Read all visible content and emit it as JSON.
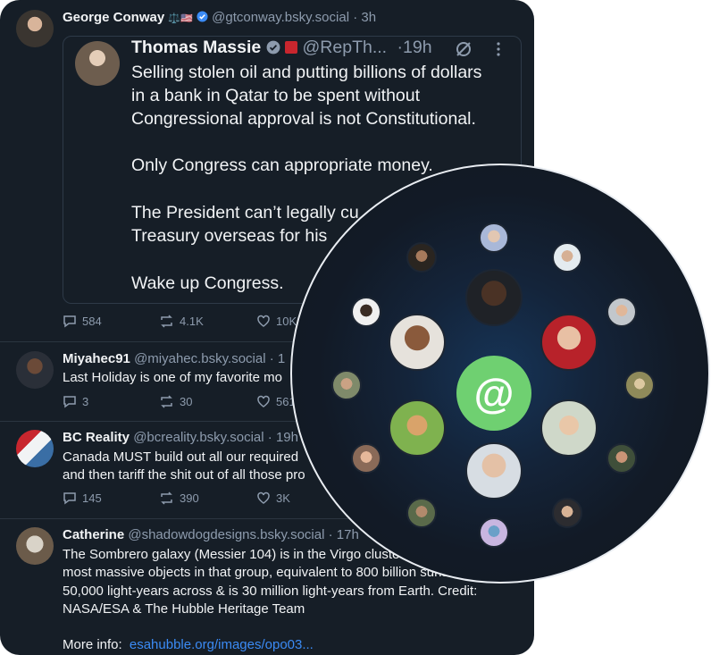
{
  "posts": [
    {
      "author": "George Conway",
      "badges": "⚖️🇺🇸",
      "handle": "@gtconway.bsky.social",
      "time": "3h",
      "quote": {
        "author": "Thomas Massie",
        "handle": "@RepTh...",
        "time": "19h",
        "lines": [
          "Selling stolen oil and putting billions of dollars",
          "in a bank in Qatar to be spent without",
          "Congressional approval is not Constitutional.",
          "",
          "Only Congress can appropriate money.",
          "",
          "The President can’t legally cu",
          "Treasury overseas for his",
          "",
          "Wake up Congress."
        ]
      },
      "replies": "584",
      "reposts": "4.1K",
      "likes": "10K"
    },
    {
      "author": "Miyahec91",
      "handle": "@miyahec.bsky.social",
      "time": "1",
      "lines": [
        "Last Holiday is one of my favorite mo"
      ],
      "replies": "3",
      "reposts": "30",
      "likes": "561"
    },
    {
      "author": "BC Reality",
      "handle": "@bcreality.bsky.social",
      "time": "19h",
      "lines": [
        "Canada MUST build out all our required",
        "and then tariff the shit out of all those pro"
      ],
      "replies": "145",
      "reposts": "390",
      "likes": "3K"
    },
    {
      "author": "Catherine",
      "handle": "@shadowdogdesigns.bsky.social",
      "time": "17h",
      "lines": [
        "The Sombrero galaxy (Messier 104) is in the Virgo cluste",
        "most massive objects in that group, equivalent to 800 billion suns. It’s",
        "50,000 light-years across & is 30 million light-years from Earth.  Credit:",
        "NASA/ESA & The Hubble Heritage Team",
        "",
        "More info:"
      ],
      "link": "esahubble.org/images/opo03..."
    }
  ],
  "sep": "·",
  "at_symbol": "@",
  "colors": {
    "background": "#161e27",
    "accent": "#6fd071",
    "link": "#3b8bf5",
    "muted": "#8d9bad"
  },
  "icons": [
    "reply-icon",
    "repost-icon",
    "like-icon",
    "verified-icon",
    "sync-icon",
    "more-icon"
  ]
}
